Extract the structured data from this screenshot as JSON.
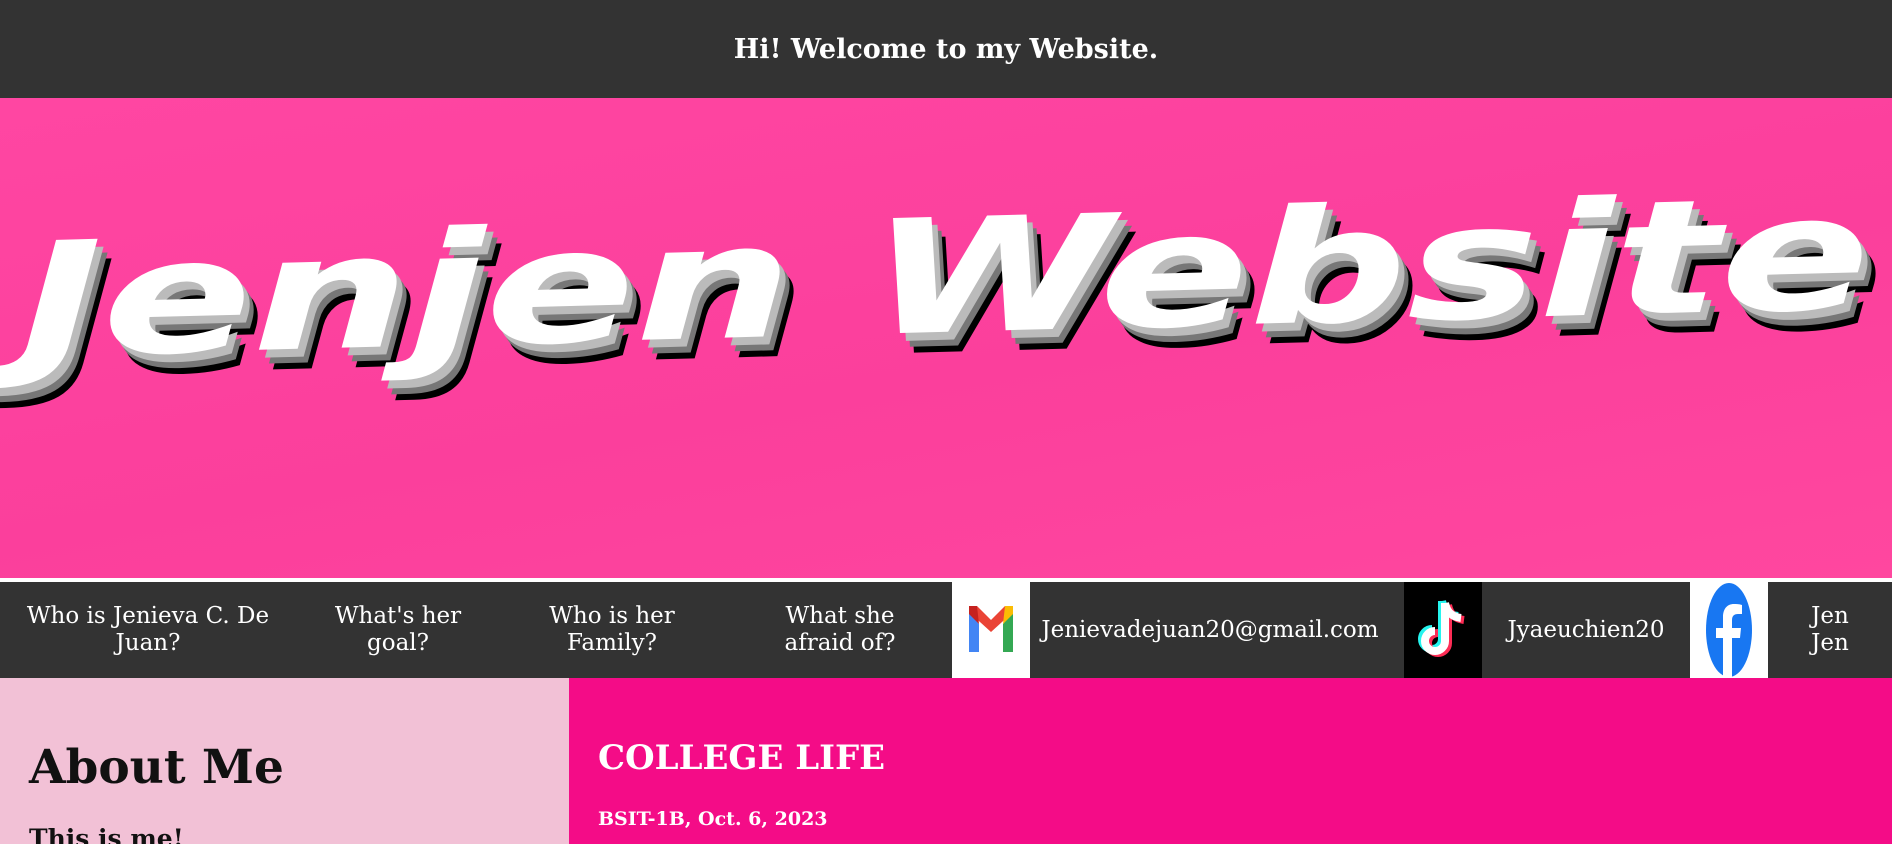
{
  "header": {
    "title": "Hi! Welcome to my Website."
  },
  "banner": {
    "text": "Jenjen Website",
    "background": "#ff449f"
  },
  "nav": {
    "items": [
      {
        "line1": "Who is Jenieva C. De",
        "line2": "Juan?"
      },
      {
        "line1": "What's her",
        "line2": "goal?"
      },
      {
        "line1": "Who is her",
        "line2": "Family?"
      },
      {
        "line1": "What she",
        "line2": "afraid of?"
      }
    ],
    "email": "Jenievadejuan20@gmail.com",
    "tiktok": "Jyaeuchien20",
    "facebook_line1": "Jen",
    "facebook_line2": "Jen",
    "icons": [
      "gmail-icon",
      "tiktok-icon",
      "facebook-icon"
    ]
  },
  "about": {
    "heading": "About Me",
    "subheading": "This is me!"
  },
  "college": {
    "heading": "COLLEGE LIFE",
    "meta": "BSIT-1B, Oct. 6, 2023"
  },
  "colors": {
    "dark": "#333333",
    "pink_banner": "#ff449f",
    "pink_light": "#f2c1d6",
    "pink_hot": "#f40c87"
  }
}
